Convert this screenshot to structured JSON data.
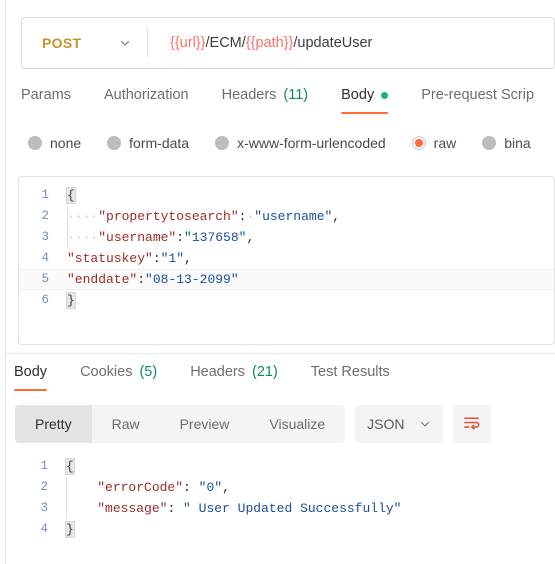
{
  "request": {
    "method": "POST",
    "method_color": "#c7932b",
    "method_dropdown_icon": "chevron-down-icon",
    "url_parts": [
      {
        "text": "{{url}}",
        "type": "variable"
      },
      {
        "text": "/ECM/",
        "type": "plain"
      },
      {
        "text": "{{path}}",
        "type": "variable"
      },
      {
        "text": "/updateUser",
        "type": "plain"
      }
    ],
    "url_full": "{{url}}/ECM/{{path}}/updateUser",
    "variable_color": "#f37468",
    "tabs": [
      {
        "label": "Params",
        "active": false,
        "count": null,
        "dot": false
      },
      {
        "label": "Authorization",
        "active": false,
        "count": null,
        "dot": false
      },
      {
        "label": "Headers",
        "active": false,
        "count": "(11)",
        "dot": false
      },
      {
        "label": "Body",
        "active": true,
        "count": null,
        "dot": true
      },
      {
        "label": "Pre-request Scrip",
        "active": false,
        "count": null,
        "dot": false
      }
    ],
    "body_types": [
      {
        "label": "none",
        "selected": false
      },
      {
        "label": "form-data",
        "selected": false
      },
      {
        "label": "x-www-form-urlencoded",
        "selected": false
      },
      {
        "label": "raw",
        "selected": true
      },
      {
        "label": "bina",
        "selected": false
      }
    ],
    "body_code": [
      {
        "num": "1",
        "active": false,
        "indent_guide": false,
        "tokens": [
          {
            "t": "{",
            "c": "brace-hl"
          }
        ]
      },
      {
        "num": "2",
        "active": false,
        "indent_guide": true,
        "tokens": [
          {
            "t": "····",
            "c": "ws"
          },
          {
            "t": "\"propertytosearch\"",
            "c": "k"
          },
          {
            "t": ":",
            "c": "p"
          },
          {
            "t": "·",
            "c": "ws"
          },
          {
            "t": "\"username\"",
            "c": "s"
          },
          {
            "t": ",",
            "c": "p"
          }
        ]
      },
      {
        "num": "3",
        "active": false,
        "indent_guide": true,
        "tokens": [
          {
            "t": "····",
            "c": "ws"
          },
          {
            "t": "\"username\"",
            "c": "k"
          },
          {
            "t": ":",
            "c": "p"
          },
          {
            "t": "\"137658\"",
            "c": "s"
          },
          {
            "t": ",",
            "c": "p"
          }
        ]
      },
      {
        "num": "4",
        "active": false,
        "indent_guide": false,
        "tokens": [
          {
            "t": "\"statuskey\"",
            "c": "k"
          },
          {
            "t": ":",
            "c": "p"
          },
          {
            "t": "\"1\"",
            "c": "s"
          },
          {
            "t": ",",
            "c": "p"
          }
        ]
      },
      {
        "num": "5",
        "active": true,
        "indent_guide": false,
        "tokens": [
          {
            "t": "\"enddate\"",
            "c": "k"
          },
          {
            "t": ":",
            "c": "p"
          },
          {
            "t": "\"08-13-2099\"",
            "c": "s"
          }
        ]
      },
      {
        "num": "6",
        "active": false,
        "indent_guide": false,
        "tokens": [
          {
            "t": "}",
            "c": "brace-hl"
          }
        ]
      }
    ]
  },
  "response": {
    "tabs": [
      {
        "label": "Body",
        "active": true,
        "count": null
      },
      {
        "label": "Cookies",
        "active": false,
        "count": "(5)"
      },
      {
        "label": "Headers",
        "active": false,
        "count": "(21)"
      },
      {
        "label": "Test Results",
        "active": false,
        "count": null
      }
    ],
    "view_modes": [
      {
        "label": "Pretty",
        "active": true
      },
      {
        "label": "Raw",
        "active": false
      },
      {
        "label": "Preview",
        "active": false
      },
      {
        "label": "Visualize",
        "active": false
      }
    ],
    "format": "JSON",
    "format_dropdown_icon": "chevron-down-icon",
    "wrap_icon": "wrap-text-icon",
    "wrap_icon_color": "#e8533a",
    "body_code": [
      {
        "num": "1",
        "active": false,
        "indent_guide": false,
        "tokens": [
          {
            "t": "{",
            "c": "brace-hl"
          }
        ]
      },
      {
        "num": "2",
        "active": false,
        "indent_guide": true,
        "tokens": [
          {
            "t": "    ",
            "c": "ws"
          },
          {
            "t": "\"errorCode\"",
            "c": "k"
          },
          {
            "t": ": ",
            "c": "p"
          },
          {
            "t": "\"0\"",
            "c": "s"
          },
          {
            "t": ",",
            "c": "p"
          }
        ]
      },
      {
        "num": "3",
        "active": false,
        "indent_guide": true,
        "tokens": [
          {
            "t": "    ",
            "c": "ws"
          },
          {
            "t": "\"message\"",
            "c": "k"
          },
          {
            "t": ": ",
            "c": "p"
          },
          {
            "t": "\" User Updated Successfully\"",
            "c": "s"
          }
        ]
      },
      {
        "num": "4",
        "active": false,
        "indent_guide": false,
        "tokens": [
          {
            "t": "}",
            "c": "brace-hl"
          }
        ]
      }
    ]
  },
  "theme": {
    "accent": "#ff6c37",
    "count_color": "#0f8a5f",
    "key_color": "#9c2b2b",
    "string_color": "#1a4f9c",
    "gutter_color": "#7590b5"
  }
}
